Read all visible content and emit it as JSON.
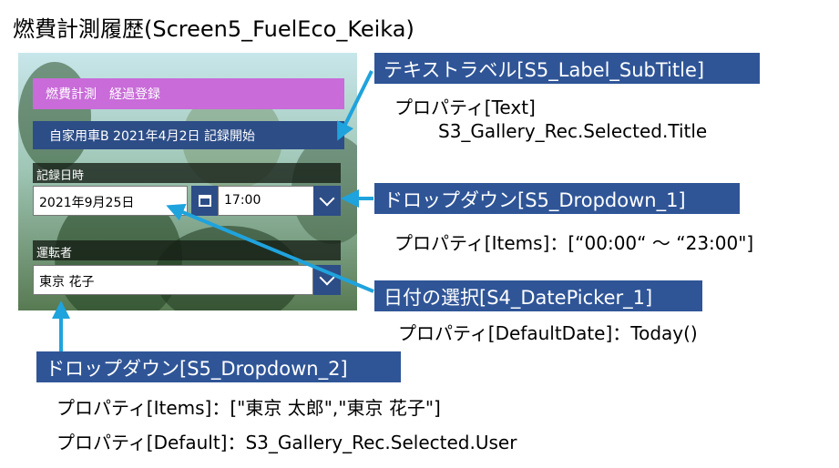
{
  "heading": "燃費計測履歴(Screen5_FuelEco_Keika)",
  "screen": {
    "title": "燃費計測　経過登録",
    "subtitle": "自家用車B 2021年4月2日 記録開始",
    "date_label": "記録日時",
    "date_value": "2021年9月25日",
    "time_value": "17:00",
    "driver_label": "運転者",
    "driver_value": "東京 花子"
  },
  "annotations": [
    {
      "title": "テキストラベル[S5_Label_SubTitle]",
      "lines": [
        "プロパティ[Text]",
        "S3_Gallery_Rec.Selected.Title"
      ]
    },
    {
      "title": "ドロップダウン[S5_Dropdown_1]",
      "lines": [
        "プロパティ[Items]：[“00:00“ ～ “23:00\"]"
      ]
    },
    {
      "title": "日付の選択[S4_DatePicker_1]",
      "lines": [
        "プロパティ[DefaultDate]：Today()"
      ]
    },
    {
      "title": "ドロップダウン[S5_Dropdown_2]",
      "lines": [
        "プロパティ[Items]：[\"東京 太郎\",\"東京 花子\"]",
        "プロパティ[Default]：S3_Gallery_Rec.Selected.User"
      ]
    }
  ],
  "colors": {
    "callout_bg": "#2f5597",
    "arrow": "#1fa3dd",
    "title_bar": "#c96bd9",
    "subtitle_bar": "#2d4d87"
  },
  "icons": [
    "calendar-icon",
    "chevron-down-icon",
    "chevron-down-icon"
  ]
}
